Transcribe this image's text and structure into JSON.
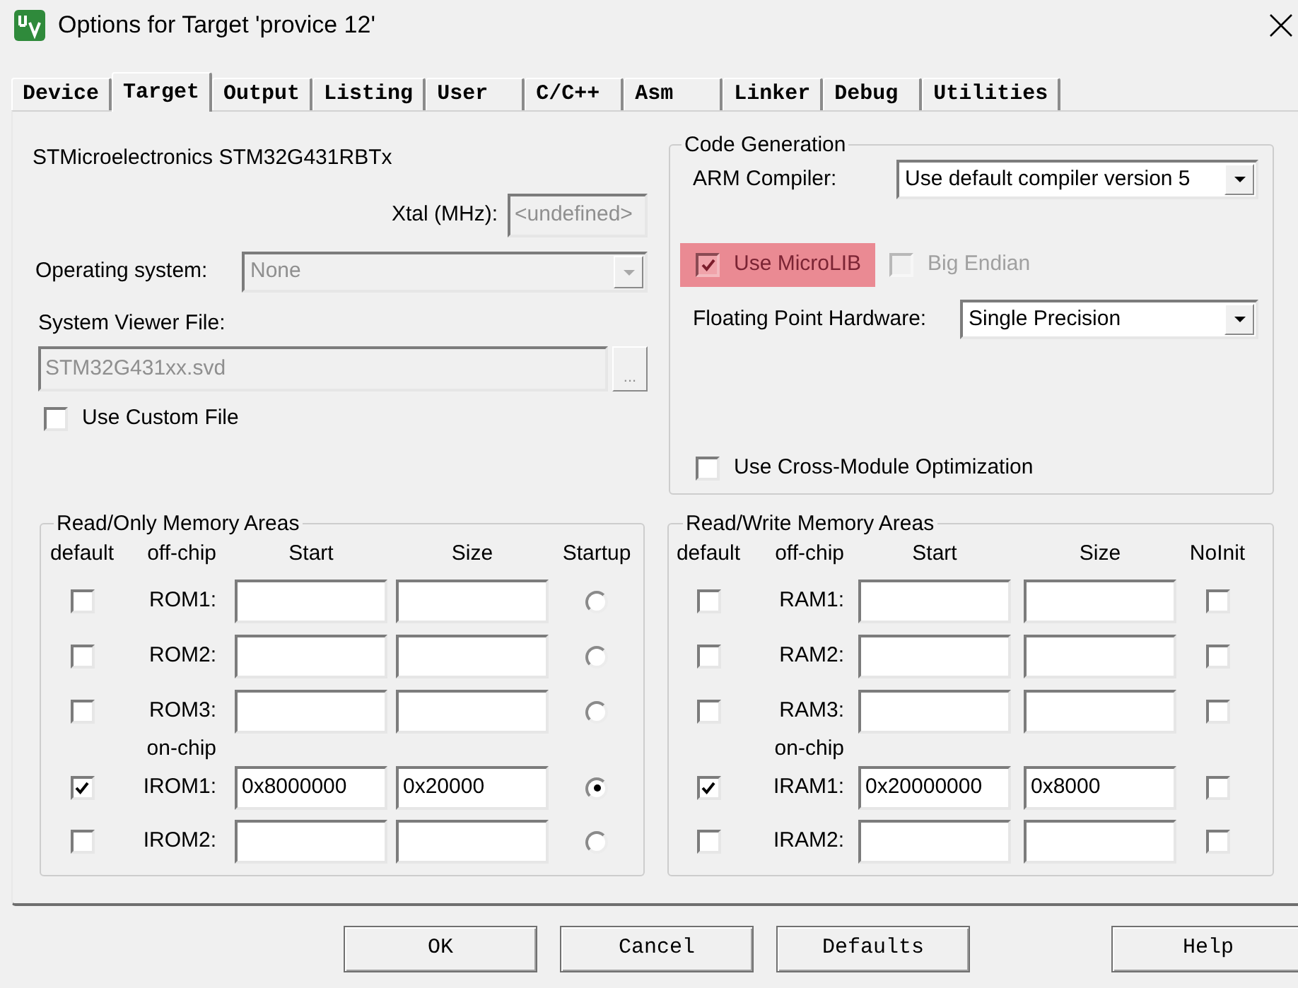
{
  "window": {
    "title": "Options for Target 'provice 12'"
  },
  "tabs": [
    {
      "label": "Device",
      "selected": false
    },
    {
      "label": "Target",
      "selected": true
    },
    {
      "label": "Output",
      "selected": false
    },
    {
      "label": "Listing",
      "selected": false
    },
    {
      "label": "User",
      "selected": false
    },
    {
      "label": "C/C++",
      "selected": false
    },
    {
      "label": "Asm",
      "selected": false
    },
    {
      "label": "Linker",
      "selected": false
    },
    {
      "label": "Debug",
      "selected": false
    },
    {
      "label": "Utilities",
      "selected": false
    }
  ],
  "device": {
    "name": "STMicroelectronics STM32G431RBTx",
    "xtal": {
      "label": "Xtal (MHz):",
      "value": "<undefined>",
      "disabled": true
    },
    "operating_system": {
      "label": "Operating system:",
      "value": "None",
      "disabled": true
    },
    "system_viewer_file": {
      "label": "System Viewer File:",
      "value": "STM32G431xx.svd",
      "disabled": true,
      "browse_button": "..."
    },
    "use_custom_file": {
      "label": "Use Custom File",
      "checked": false
    }
  },
  "code_generation": {
    "title": "Code Generation",
    "arm_compiler": {
      "label": "ARM Compiler:",
      "value": "Use default compiler version 5"
    },
    "options": [
      {
        "label": "Use MicroLIB",
        "checked": true,
        "disabled": false,
        "highlighted": true
      },
      {
        "label": "Big Endian",
        "checked": false,
        "disabled": true,
        "highlighted": false
      }
    ],
    "floating_point_hardware": {
      "label": "Floating Point Hardware:",
      "value": "Single Precision"
    },
    "cross_module_optimization": {
      "label": "Use Cross-Module Optimization",
      "checked": false
    }
  },
  "read_only_memory": {
    "title": "Read/Only Memory Areas",
    "columns": [
      "default",
      "off-chip",
      "Start",
      "Size",
      "Startup"
    ],
    "off_chip_rows": [
      {
        "label": "ROM1:",
        "default": false,
        "selected": false
      },
      {
        "label": "ROM2:",
        "default": false,
        "selected": false
      },
      {
        "label": "ROM3:",
        "default": false,
        "selected": false
      }
    ],
    "on_chip_label": "on-chip",
    "on_chip_rows": [
      {
        "label": "IROM1:",
        "default": true,
        "start": "0x8000000",
        "size": "0x20000",
        "selected": true
      },
      {
        "label": "IROM2:",
        "default": false,
        "selected": false
      }
    ]
  },
  "read_write_memory": {
    "title": "Read/Write Memory Areas",
    "columns": [
      "default",
      "off-chip",
      "Start",
      "Size",
      "NoInit"
    ],
    "off_chip_rows": [
      {
        "label": "RAM1:",
        "default": false,
        "no_init": false
      },
      {
        "label": "RAM2:",
        "default": false,
        "no_init": false
      },
      {
        "label": "RAM3:",
        "default": false,
        "no_init": false
      }
    ],
    "on_chip_label": "on-chip",
    "on_chip_rows": [
      {
        "label": "IRAM1:",
        "default": true,
        "start": "0x20000000",
        "size": "0x8000",
        "no_init": false
      },
      {
        "label": "IRAM2:",
        "default": false,
        "no_init": false
      }
    ]
  },
  "buttons": [
    "OK",
    "Cancel",
    "Defaults",
    "Help"
  ]
}
